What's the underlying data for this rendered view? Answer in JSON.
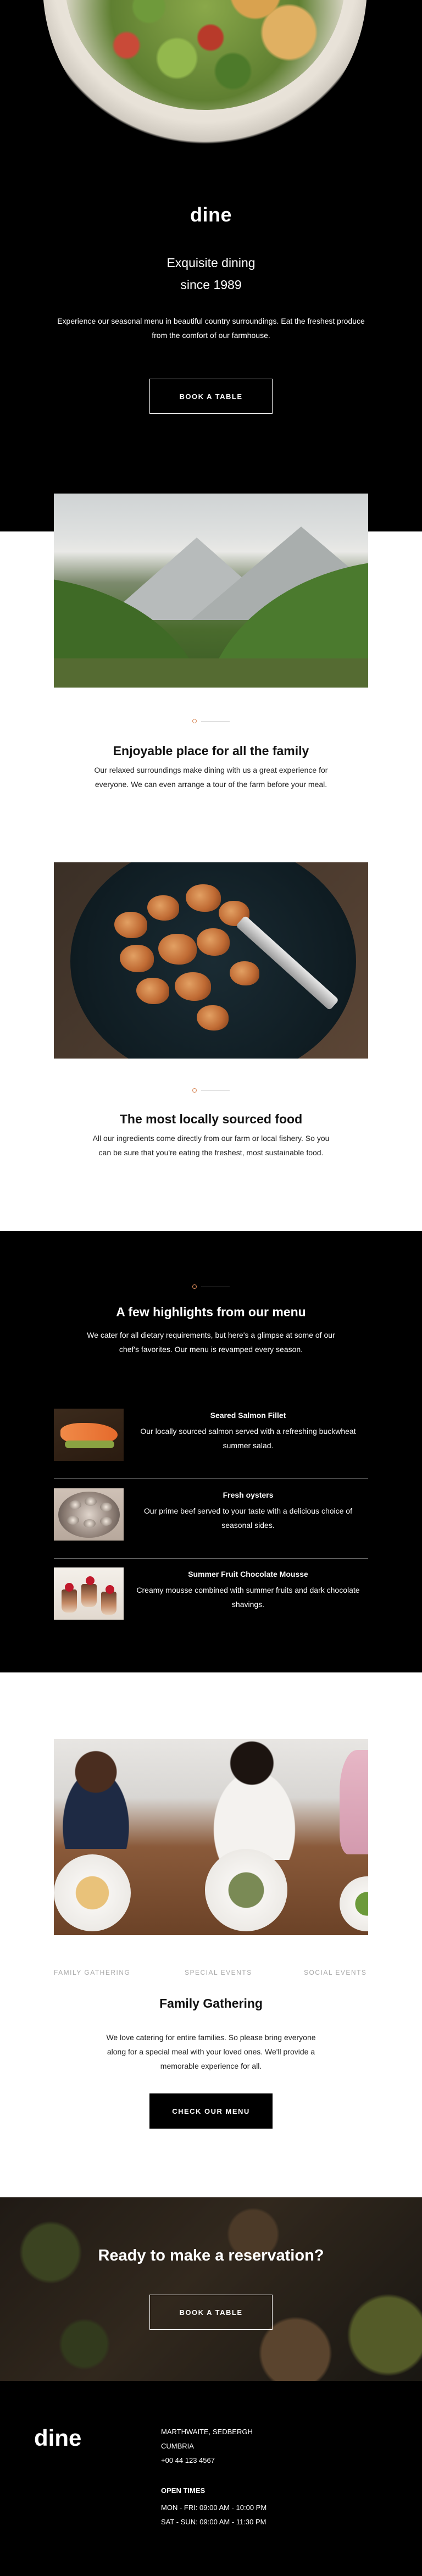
{
  "hero": {
    "logo": "dine",
    "subtitle_line1": "Exquisite dining",
    "subtitle_line2": "since 1989",
    "description": "Experience our seasonal menu in beautiful country surroundings. Eat the freshest produce from the comfort of our farmhouse.",
    "button": "BOOK A TABLE"
  },
  "about": {
    "title": "Enjoyable place for all the family",
    "text": "Our relaxed surroundings make dining with us a great experience for everyone. We can even arrange a tour of the farm before your meal."
  },
  "sourced": {
    "title": "The most locally sourced food",
    "text": "All our ingredients come directly from our farm or local fishery. So you can be sure that you're eating the freshest, most sustainable food."
  },
  "highlights": {
    "title": "A few highlights from our menu",
    "subtitle": "We cater for all dietary requirements, but here's a glimpse at some of our chef's favorites. Our menu is revamped every season.",
    "items": [
      {
        "name": "Seared Salmon Fillet",
        "description": "Our locally sourced salmon served with a refreshing buckwheat summer salad."
      },
      {
        "name": "Fresh oysters",
        "description": "Our prime beef served to your taste with a delicious choice of seasonal sides."
      },
      {
        "name": "Summer Fruit Chocolate Mousse",
        "description": "Creamy mousse combined with summer fruits and dark chocolate shavings."
      }
    ]
  },
  "events": {
    "tabs": [
      "FAMILY GATHERING",
      "SPECIAL EVENTS",
      "SOCIAL EVENTS"
    ],
    "title": "Family Gathering",
    "text": "We love catering for entire families. So please bring everyone along for a special meal with your loved ones. We'll provide a memorable experience for all.",
    "button": "CHECK OUR MENU"
  },
  "reservation": {
    "title": "Ready to make a reservation?",
    "button": "BOOK A TABLE"
  },
  "footer": {
    "logo": "dine",
    "address": [
      "MARTHWAITE, SEDBERGH",
      "CUMBRIA",
      "+00 44 123 4567"
    ],
    "hours_title": "OPEN TIMES",
    "hours": [
      "MON - FRI: 09:00 AM - 10:00 PM",
      "SAT - SUN: 09:00 AM - 11:30 PM"
    ]
  },
  "colors": {
    "background_dark": "#000000",
    "accent_divider": "#d98a5a",
    "text_light": "#ffffff",
    "tab_inactive": "#a9a9a9"
  }
}
